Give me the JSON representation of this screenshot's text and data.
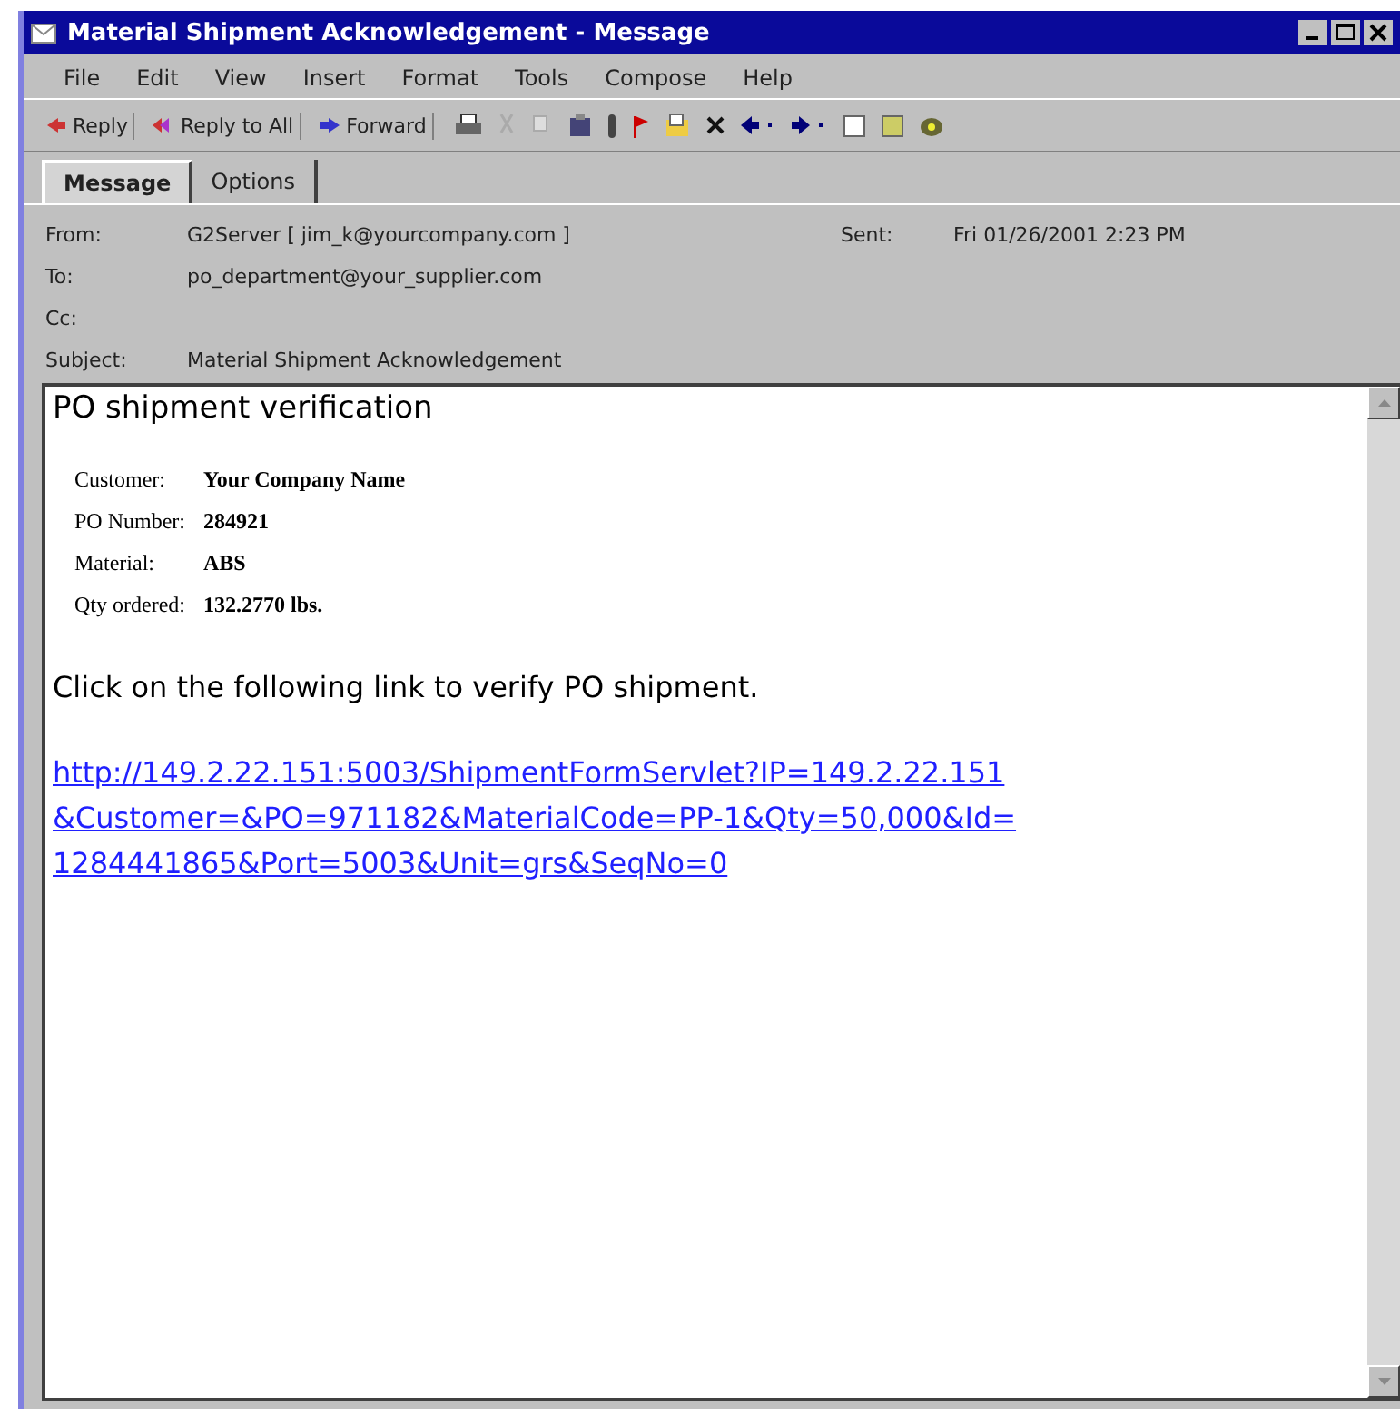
{
  "window": {
    "title": "Material Shipment Acknowledgement - Message"
  },
  "menu": [
    "File",
    "Edit",
    "View",
    "Insert",
    "Format",
    "Tools",
    "Compose",
    "Help"
  ],
  "toolbar": [
    {
      "kind": "reply",
      "label": "Reply"
    },
    {
      "kind": "reply-all",
      "label": "Reply to All"
    },
    {
      "kind": "forward",
      "label": "Forward"
    }
  ],
  "tabs": [
    {
      "label": "Message",
      "selected": true
    },
    {
      "label": "Options",
      "selected": false
    }
  ],
  "header": {
    "from_label": "From:",
    "from": "G2Server [ jim_k@yourcompany.com ]",
    "sent_label": "Sent:",
    "sent": "Fri 01/26/2001 2:23 PM",
    "to_label": "To:",
    "to": "po_department@your_supplier.com",
    "cc_label": "Cc:",
    "subject_label": "Subject:",
    "subject": "Material Shipment Acknowledgement"
  },
  "body": {
    "heading": "PO shipment verification",
    "details": [
      {
        "label": "Customer:",
        "value": "Your Company Name"
      },
      {
        "label": "PO Number:",
        "value": "284921"
      },
      {
        "label": "Material:",
        "value": "ABS"
      },
      {
        "label": "Qty ordered:",
        "value": "132.2770 lbs."
      }
    ],
    "instruction": "Click on the following link to verify PO shipment.",
    "link_lines": [
      "http://149.2.22.151:5003/ShipmentFormServlet?IP=149.2.22.151",
      "&Customer=&PO=971182&MaterialCode=PP-1&Qty=50,000&Id=",
      "1284441865&Port=5003&Unit=grs&SeqNo=0"
    ]
  }
}
